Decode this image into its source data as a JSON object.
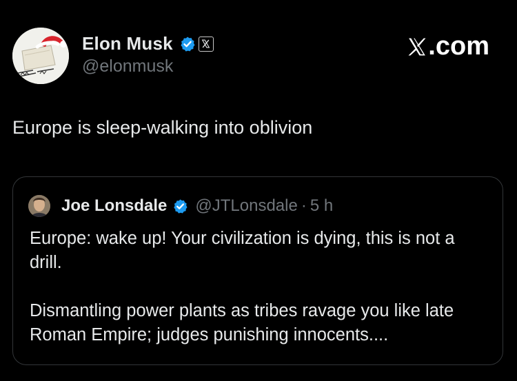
{
  "author": {
    "name": "Elon Musk",
    "handle": "@elonmusk"
  },
  "brand": {
    "label": ".com"
  },
  "tweet": {
    "text": "Europe is sleep-walking into oblivion"
  },
  "quoted": {
    "name": "Joe Lonsdale",
    "handle": "@JTLonsdale",
    "separator": "·",
    "time": "5 h",
    "paragraph1": "Europe: wake up! Your civilization is dying, this is not a drill.",
    "paragraph2": "Dismantling power plants as tribes ravage you like late Roman Empire; judges punishing innocents...."
  },
  "colors": {
    "background": "#000000",
    "text": "#e7e9ea",
    "muted": "#71767b",
    "verified": "#1d9bf0",
    "border": "#333639"
  },
  "icons": [
    "verified-badge-icon",
    "x-affiliate-badge-icon",
    "x-logo-icon"
  ]
}
